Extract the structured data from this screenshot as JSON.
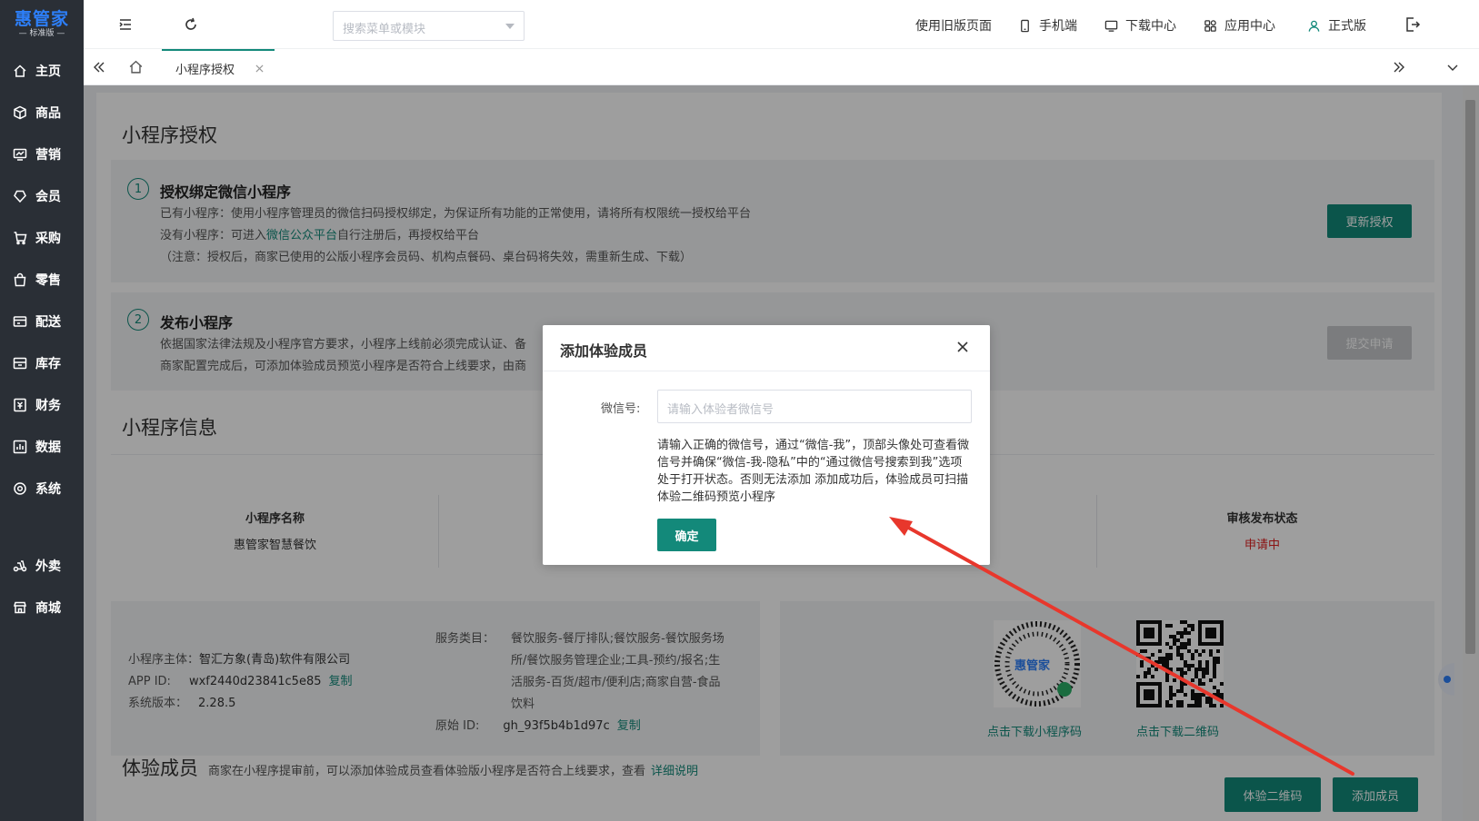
{
  "sidebar": {
    "logo": {
      "main": "惠管家",
      "sub": "— 标准版 —"
    },
    "items": [
      {
        "label": "主页",
        "icon": "home-icon"
      },
      {
        "label": "商品",
        "icon": "box-icon"
      },
      {
        "label": "营销",
        "icon": "marketing-icon"
      },
      {
        "label": "会员",
        "icon": "member-icon"
      },
      {
        "label": "采购",
        "icon": "purchase-icon"
      },
      {
        "label": "零售",
        "icon": "retail-icon"
      },
      {
        "label": "配送",
        "icon": "delivery-icon"
      },
      {
        "label": "库存",
        "icon": "inventory-icon"
      },
      {
        "label": "财务",
        "icon": "finance-icon"
      },
      {
        "label": "数据",
        "icon": "data-icon"
      },
      {
        "label": "系统",
        "icon": "settings-icon"
      },
      {
        "label": "外卖",
        "icon": "takeout-icon"
      },
      {
        "label": "商城",
        "icon": "mall-icon"
      }
    ]
  },
  "header": {
    "search_placeholder": "搜索菜单或模块",
    "links": {
      "old_page": "使用旧版页面",
      "mobile": "手机端",
      "download": "下载中心",
      "apps": "应用中心",
      "version": "正式版"
    }
  },
  "tabs": [
    {
      "label": "小程序授权",
      "active": true
    }
  ],
  "page": {
    "title": "小程序授权",
    "step1": {
      "num": "1",
      "title": "授权绑定微信小程序",
      "line1": "已有小程序：使用小程序管理员的微信扫码授权绑定，为保证所有功能的正常使用，请将所有权限统一授权给平台",
      "line2_prefix": "没有小程序：可进入",
      "line2_link": "微信公众平台",
      "line2_suffix": "自行注册后，再授权给平台",
      "line3": "（注意：授权后，商家已使用的公版小程序会员码、机构点餐码、桌台码将失效，需重新生成、下载）",
      "button": "更新授权"
    },
    "step2": {
      "num": "2",
      "title": "发布小程序",
      "line1": "依据国家法律法规及小程序官方要求，小程序上线前必须完成认证、备",
      "line2": "商家配置完成后，可添加体验成员预览小程序是否符合上线要求，由商",
      "button": "提交申请"
    },
    "info": {
      "title": "小程序信息",
      "name_label": "小程序名称",
      "name_value": "惠管家智慧餐饮",
      "status_label": "审核发布状态",
      "status_value": "申请中"
    },
    "details": {
      "subject_label": "小程序主体：",
      "subject_value": "智汇方象(青岛)软件有限公司",
      "appid_label": "APP ID:",
      "appid_value": "wxf2440d23841c5e85",
      "copy": "复制",
      "version_label": "系统版本：",
      "version_value": "2.28.5",
      "service_label": "服务类目：",
      "service_lines": [
        "餐饮服务-餐厅排队;餐饮服务-餐饮服务场",
        "所/餐饮服务管理企业;工具-预约/报名;生",
        "活服务-百货/超市/便利店;商家自营-食品",
        "饮料"
      ],
      "origin_label": "原始 ID:",
      "origin_value": "gh_93f5b4b1d97c"
    },
    "qr": {
      "mini_link": "点击下载小程序码",
      "qr_link": "点击下载二维码",
      "mini_brand": "惠管家"
    },
    "members": {
      "title": "体验成员",
      "note_prefix": "商家在小程序提审前，可以添加体验成员查看体验版小程序是否符合上线要求，查看",
      "note_link": "详细说明",
      "btn_qr": "体验二维码",
      "btn_add": "添加成员"
    }
  },
  "dialog": {
    "title": "添加体验成员",
    "label": "微信号:",
    "placeholder": "请输入体验者微信号",
    "help": "请输入正确的微信号，通过“微信-我”，顶部头像处可查看微信号并确保“微信-我-隐私”中的“通过微信号搜索到我”选项处于打开状态。否则无法添加 添加成功后，体验成员可扫描体验二维码预览小程序",
    "ok": "确定"
  },
  "colors": {
    "accent": "#13897a",
    "sidebar": "#2a2f36",
    "logo": "#2d7ff9",
    "status": "#e02020",
    "arrow": "#e8372c"
  }
}
